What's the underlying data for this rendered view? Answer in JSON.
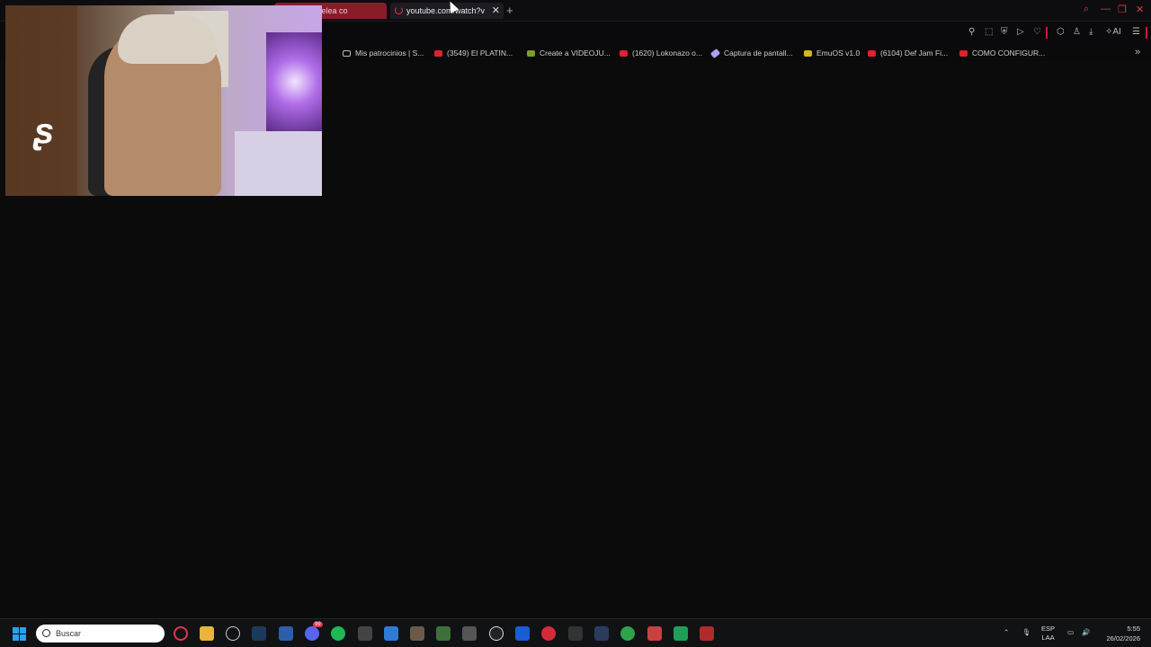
{
  "browser": {
    "tabs": [
      {
        "label": "Undertale pelea co",
        "active": false
      },
      {
        "label": "youtube.com/watch?v",
        "active": true
      }
    ],
    "new_tab": "+",
    "toolbar_ai_label": "AI",
    "bookmarks": [
      {
        "label": "Mis patrocinios | S...",
        "icon": "doc-icon"
      },
      {
        "label": "(3549) El PLATIN...",
        "icon": "youtube-icon"
      },
      {
        "label": "Create a VIDEOJU...",
        "icon": "grid-icon"
      },
      {
        "label": "(1620) Lokonazo o...",
        "icon": "youtube-icon"
      },
      {
        "label": "Captura de pantall...",
        "icon": "pen-icon"
      },
      {
        "label": "EmuOS v1.0",
        "icon": "sun-icon"
      },
      {
        "label": "(6104) Def Jam Fi...",
        "icon": "youtube-icon"
      },
      {
        "label": "COMO CONFIGUR...",
        "icon": "youtube-icon"
      }
    ],
    "bookmarks_more": "»"
  },
  "taskbar": {
    "search_placeholder": "Buscar",
    "lang_top": "ESP",
    "lang_bottom": "LAA",
    "time": "5:55",
    "date": "26/02/2026",
    "chat_badge": "99"
  },
  "colors": {
    "accent": "#e0384b",
    "tab_active_bg": "#1c1c22",
    "tab_inactive_bg": "#8a1c2a"
  }
}
